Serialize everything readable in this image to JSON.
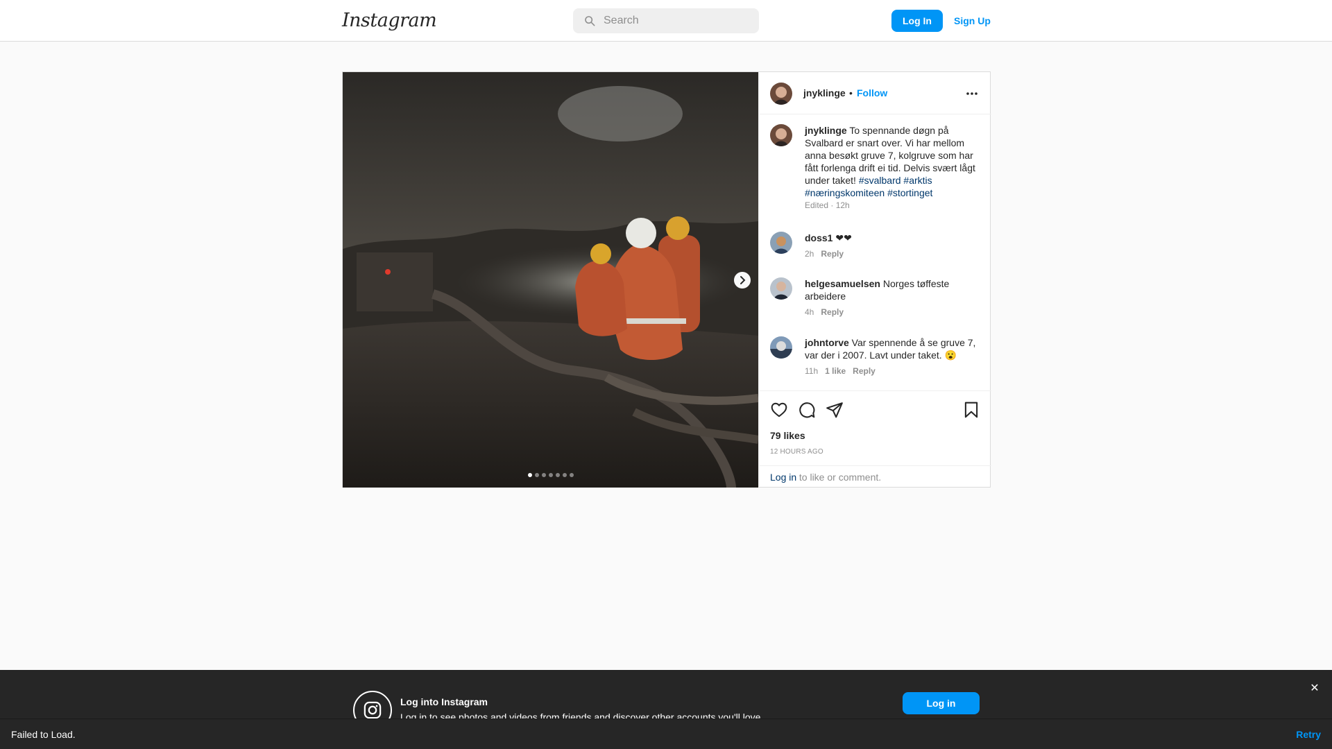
{
  "nav": {
    "logo": "Instagram",
    "search_placeholder": "Search",
    "login_label": "Log In",
    "signup_label": "Sign Up"
  },
  "post": {
    "author": "jnyklinge",
    "separator": "•",
    "follow_label": "Follow",
    "more_icon": "more-horizontal-icon",
    "carousel": {
      "slide_count": 7,
      "active_index": 0
    },
    "caption": {
      "user": "jnyklinge",
      "text": "To spennande døgn på Svalbard er snart over. Vi har mellom anna besøkt gruve 7, kolgruve som har fått forlenga drift ei tid. Delvis svært lågt under taket!",
      "hashtags": [
        "#svalbard",
        "#arktis",
        "#næringskomiteen",
        "#stortinget"
      ],
      "meta": "Edited · 12h"
    },
    "comments": [
      {
        "user": "doss1",
        "text": "❤❤",
        "time": "2h",
        "likes": "",
        "reply_label": "Reply"
      },
      {
        "user": "helgesamuelsen",
        "text": "Norges tøffeste arbeidere",
        "time": "4h",
        "likes": "",
        "reply_label": "Reply"
      },
      {
        "user": "johntorve",
        "text": "Var spennende å se gruve 7, var der i 2007. Lavt under taket. 😮",
        "time": "11h",
        "likes": "1 like",
        "reply_label": "Reply"
      }
    ],
    "likes": "79 likes",
    "time_ago": "12 HOURS AGO",
    "login_prompt": {
      "link": "Log in",
      "rest": " to like or comment."
    }
  },
  "banner": {
    "title": "Log into Instagram",
    "subtitle": "Log in to see photos and videos from friends and discover other accounts you'll love.",
    "button_label": "Log in",
    "close_glyph": "✕"
  },
  "toast": {
    "message": "Failed to Load.",
    "retry_label": "Retry"
  },
  "colors": {
    "accent": "#0095f6",
    "hashtag": "#00376b",
    "muted": "#8e8e8e",
    "banner_bg": "#262626"
  }
}
